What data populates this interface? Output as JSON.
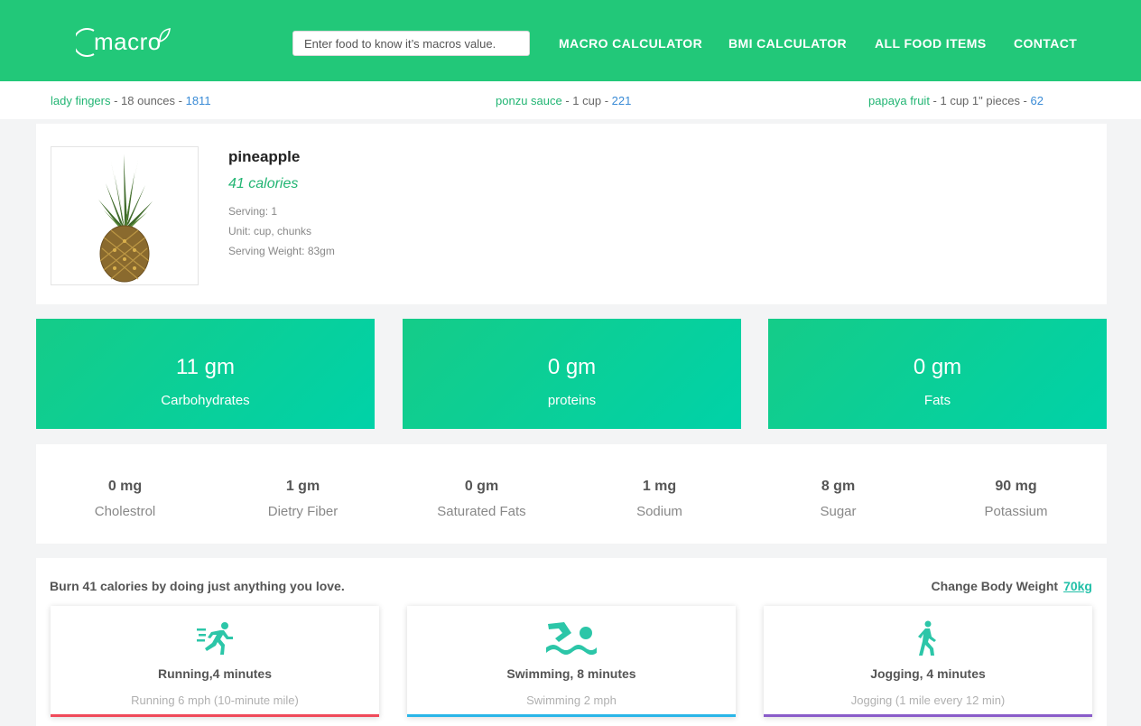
{
  "header": {
    "logo": "macro",
    "search_placeholder": "Enter food to know it’s macros value.",
    "nav": [
      "MACRO CALCULATOR",
      "BMI CALCULATOR",
      "ALL FOOD ITEMS",
      "CONTACT"
    ]
  },
  "ticker": [
    {
      "name": "lady fingers",
      "serving": " - 18 ounces - ",
      "value": "1811"
    },
    {
      "name": "ponzu sauce",
      "serving": " - 1 cup - ",
      "value": "221"
    },
    {
      "name": "papaya fruit",
      "serving": " - 1 cup 1\" pieces - ",
      "value": "62"
    }
  ],
  "food": {
    "name": "pineapple",
    "calories": "41 calories",
    "serving": "Serving: 1",
    "unit": "Unit: cup, chunks",
    "weight": "Serving Weight: 83gm"
  },
  "macros": [
    {
      "amount": "11 gm",
      "label": "Carbohydrates"
    },
    {
      "amount": "0 gm",
      "label": "proteins"
    },
    {
      "amount": "0 gm",
      "label": "Fats"
    }
  ],
  "nutrients": [
    {
      "value": "0 mg",
      "label": "Cholestrol"
    },
    {
      "value": "1 gm",
      "label": "Dietry Fiber"
    },
    {
      "value": "0 gm",
      "label": "Saturated Fats"
    },
    {
      "value": "1 mg",
      "label": "Sodium"
    },
    {
      "value": "8 gm",
      "label": "Sugar"
    },
    {
      "value": "90 mg",
      "label": "Potassium"
    }
  ],
  "burn": {
    "title": "Burn 41 calories by doing just anything you love.",
    "weight_label": "Change Body Weight",
    "weight_value": "70kg",
    "activities": [
      {
        "title": "Running,4 minutes",
        "subtitle": "Running 6 mph (10-minute mile)",
        "icon": "running-icon",
        "bar_color": "#f04a5a"
      },
      {
        "title": "Swimming, 8 minutes",
        "subtitle": "Swimming 2 mph",
        "icon": "swimming-icon",
        "bar_color": "#2ab6e8"
      },
      {
        "title": "Jogging, 4 minutes",
        "subtitle": "Jogging (1 mile every 12 min)",
        "icon": "walking-icon",
        "bar_color": "#8a5cc9"
      }
    ]
  },
  "colors": {
    "brand": "#22c879",
    "accent": "#22b573",
    "link": "#3a8bd6",
    "icon": "#2cc6a8"
  }
}
